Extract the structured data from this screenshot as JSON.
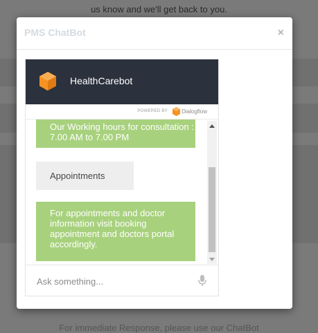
{
  "background": {
    "top_text": "us know and we'll get back to you.",
    "bottom_text": "For immediate Response, please use our ChatBot"
  },
  "modal": {
    "title": "PMS ChatBot",
    "close_label": "×"
  },
  "chat": {
    "bot_name": "HealthCarebot",
    "powered_by": "POWERED BY",
    "provider": "Dialogflow",
    "messages": [
      {
        "from": "bot",
        "text": "Our Working hours for consultation : 7.00 AM to 7.00 PM"
      },
      {
        "from": "user",
        "text": "Appointments"
      },
      {
        "from": "bot",
        "text": "For appointments and doctor information visit booking appointment and doctors portal accordingly."
      }
    ],
    "input_placeholder": "Ask something..."
  },
  "colors": {
    "header_bg": "#2b313d",
    "bot_bubble": "#a8d17d",
    "user_bubble": "#eeeeee",
    "logo_orange": "#f59322"
  },
  "icons": {
    "bot_logo": "bot-cube-icon",
    "provider_logo": "dialogflow-icon",
    "mic": "microphone-icon",
    "close": "close-icon"
  }
}
